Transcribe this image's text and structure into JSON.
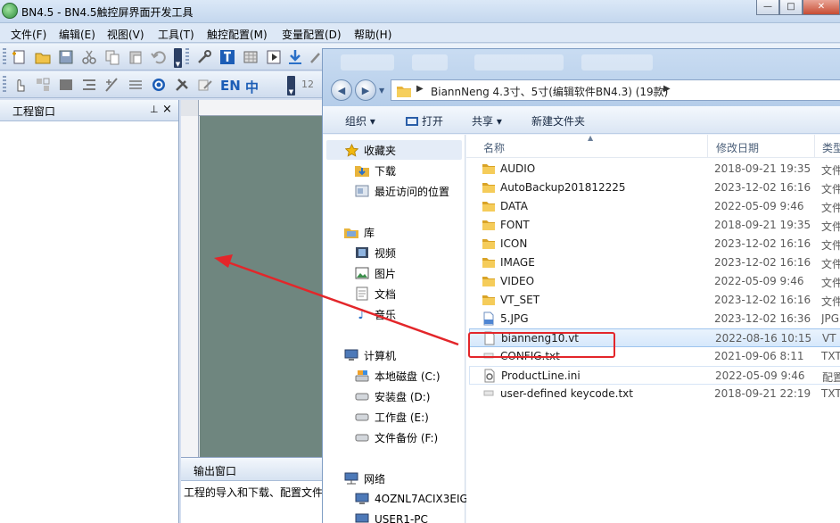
{
  "app": {
    "title": "BN4.5 - BN4.5触控屏界面开发工具",
    "controls": {
      "minimize": "—",
      "maximize": "□",
      "close": "✕"
    }
  },
  "menu": [
    {
      "label": "文件(F)"
    },
    {
      "label": "编辑(E)"
    },
    {
      "label": "视图(V)"
    },
    {
      "label": "工具(T)"
    },
    {
      "label": "触控配置(M)"
    },
    {
      "label": "变量配置(D)"
    },
    {
      "label": "帮助(H)"
    }
  ],
  "toolbar2": {
    "lang_en": "EN",
    "lang_zh": "中",
    "num_label": "12"
  },
  "project_panel": {
    "title": "工程窗口",
    "pin_icon": "pin-icon",
    "close_icon": "close-icon"
  },
  "output_panel": {
    "title": "输出窗口",
    "text": "工程的导入和下载、配置文件"
  },
  "explorer": {
    "address": {
      "path": "BiannNeng 4.3寸、5寸(编辑软件BN4.3) (19款)"
    },
    "commands": {
      "organize": "组织 ▾",
      "open": "打开",
      "share": "共享 ▾",
      "new_folder": "新建文件夹"
    },
    "nav": {
      "favorites": "收藏夹",
      "downloads": "下载",
      "recent": "最近访问的位置",
      "library": "库",
      "videos": "视频",
      "pictures": "图片",
      "documents": "文档",
      "music": "音乐",
      "computer": "计算机",
      "disk_c": "本地磁盘 (C:)",
      "disk_d": "安装盘 (D:)",
      "disk_e": "工作盘 (E:)",
      "disk_f": "文件备份 (F:)",
      "network": "网络",
      "net_pc1": "4OZNL7ACIX3EIG",
      "net_pc2": "USER1-PC"
    },
    "columns": {
      "name": "名称",
      "date": "修改日期",
      "type": "类型"
    },
    "files": [
      {
        "name": "AUDIO",
        "date": "2018-09-21 19:35",
        "type": "文件",
        "icon": "folder-icon"
      },
      {
        "name": "AutoBackup201812225",
        "date": "2023-12-02 16:16",
        "type": "文件",
        "icon": "folder-icon"
      },
      {
        "name": "DATA",
        "date": "2022-05-09 9:46",
        "type": "文件",
        "icon": "folder-icon"
      },
      {
        "name": "FONT",
        "date": "2018-09-21 19:35",
        "type": "文件",
        "icon": "folder-icon"
      },
      {
        "name": "ICON",
        "date": "2023-12-02 16:16",
        "type": "文件",
        "icon": "folder-icon"
      },
      {
        "name": "IMAGE",
        "date": "2023-12-02 16:16",
        "type": "文件",
        "icon": "folder-icon"
      },
      {
        "name": "VIDEO",
        "date": "2022-05-09 9:46",
        "type": "文件",
        "icon": "folder-icon"
      },
      {
        "name": "VT_SET",
        "date": "2023-12-02 16:16",
        "type": "文件",
        "icon": "folder-icon"
      },
      {
        "name": "5.JPG",
        "date": "2023-12-02 16:36",
        "type": "JPG",
        "icon": "jpg-file-icon"
      },
      {
        "name": "bianneng10.vt",
        "date": "2022-08-16 10:15",
        "type": "VT",
        "icon": "file-icon"
      },
      {
        "name": "CONFIG.txt",
        "date": "2021-09-06 8:11",
        "type": "TXT",
        "icon": "text-file-icon"
      },
      {
        "name": "ProductLine.ini",
        "date": "2022-05-09 9:46",
        "type": "配置",
        "icon": "ini-file-icon"
      },
      {
        "name": "user-defined keycode.txt",
        "date": "2018-09-21 22:19",
        "type": "TXT",
        "icon": "text-file-icon"
      }
    ]
  },
  "annotation": {
    "color": "#e3262a"
  }
}
